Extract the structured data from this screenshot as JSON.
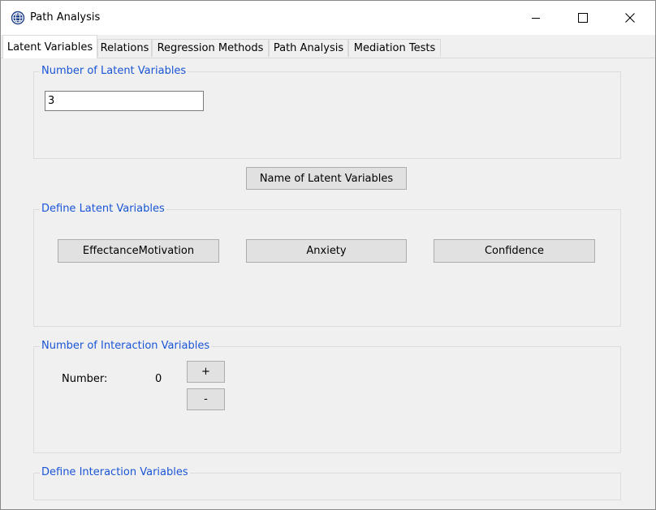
{
  "window": {
    "title": "Path Analysis",
    "app_icon": "globe-app-icon",
    "controls": {
      "minimize": "minimize-icon",
      "maximize": "maximize-icon",
      "close": "close-icon"
    }
  },
  "tabs": [
    {
      "label": "Latent Variables",
      "active": true
    },
    {
      "label": "Relations",
      "active": false
    },
    {
      "label": "Regression Methods",
      "active": false
    },
    {
      "label": "Path Analysis",
      "active": false
    },
    {
      "label": "Mediation Tests",
      "active": false
    }
  ],
  "groups": {
    "num_latent": {
      "title": "Number of Latent Variables",
      "value": "3"
    },
    "name_button": "Name of Latent Variables",
    "define_latent": {
      "title": "Define Latent Variables",
      "variables": [
        "EffectanceMotivation",
        "Anxiety",
        "Confidence"
      ]
    },
    "num_interaction": {
      "title": "Number of Interaction Variables",
      "label": "Number:",
      "value": "0",
      "plus": "+",
      "minus": "-"
    },
    "define_interaction": {
      "title": "Define Interaction Variables"
    }
  },
  "colors": {
    "legend": "#1a55d6",
    "background": "#f0f0f0",
    "button": "#e1e1e1"
  }
}
